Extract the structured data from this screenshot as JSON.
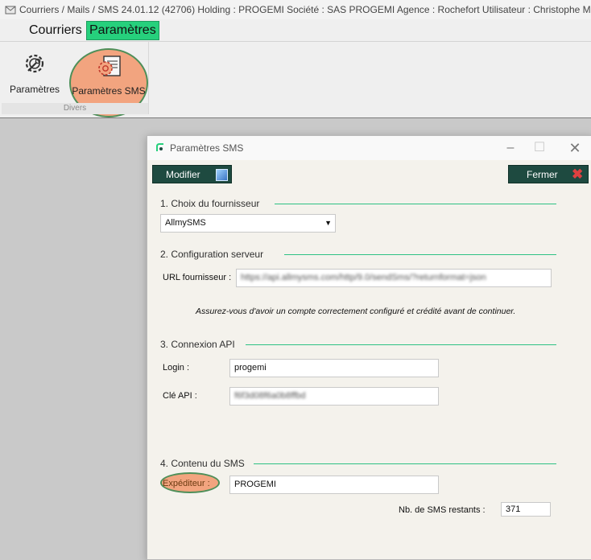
{
  "window": {
    "title": "Courriers / Mails / SMS 24.01.12 (42706)   Holding : PROGEMI   Société : SAS PROGEMI   Agence : Rochefort   Utilisateur : Christophe M"
  },
  "menu": {
    "items": [
      "Courriers",
      "Paramètres"
    ],
    "active": "Paramètres"
  },
  "ribbon": {
    "group_label": "Divers",
    "buttons": [
      {
        "label": "Paramètres",
        "icon": "gear-wrench-icon"
      },
      {
        "label": "Paramètres SMS",
        "icon": "sms-settings-icon",
        "highlighted": true
      }
    ]
  },
  "dialog": {
    "title": "Paramètres SMS",
    "buttons": {
      "modifier": "Modifier",
      "fermer": "Fermer"
    },
    "sections": [
      "1. Choix du fournisseur",
      "2. Configuration serveur",
      "3. Connexion API",
      "4. Contenu du SMS"
    ],
    "provider": {
      "selected": "AllmySMS"
    },
    "server": {
      "url_label": "URL fournisseur :",
      "url_value": "https://api.allmysms.com/http/9.0/sendSms/?returnformat=json",
      "note": "Assurez-vous d'avoir un compte correctement configuré et crédité avant de continuer."
    },
    "api": {
      "login_label": "Login :",
      "login_value": "progemi",
      "key_label": "Clé API :",
      "key_value": "f6f3d08f6a0b8ffbd"
    },
    "sms": {
      "sender_label": "Expéditeur :",
      "sender_value": "PROGEMI",
      "remaining_label": "Nb. de SMS restants :",
      "remaining_value": "371"
    }
  },
  "colors": {
    "accent_green": "#26d07c",
    "dialog_button": "#1e4a40",
    "highlight": "#f2a47f",
    "section_line": "#2dc183"
  }
}
